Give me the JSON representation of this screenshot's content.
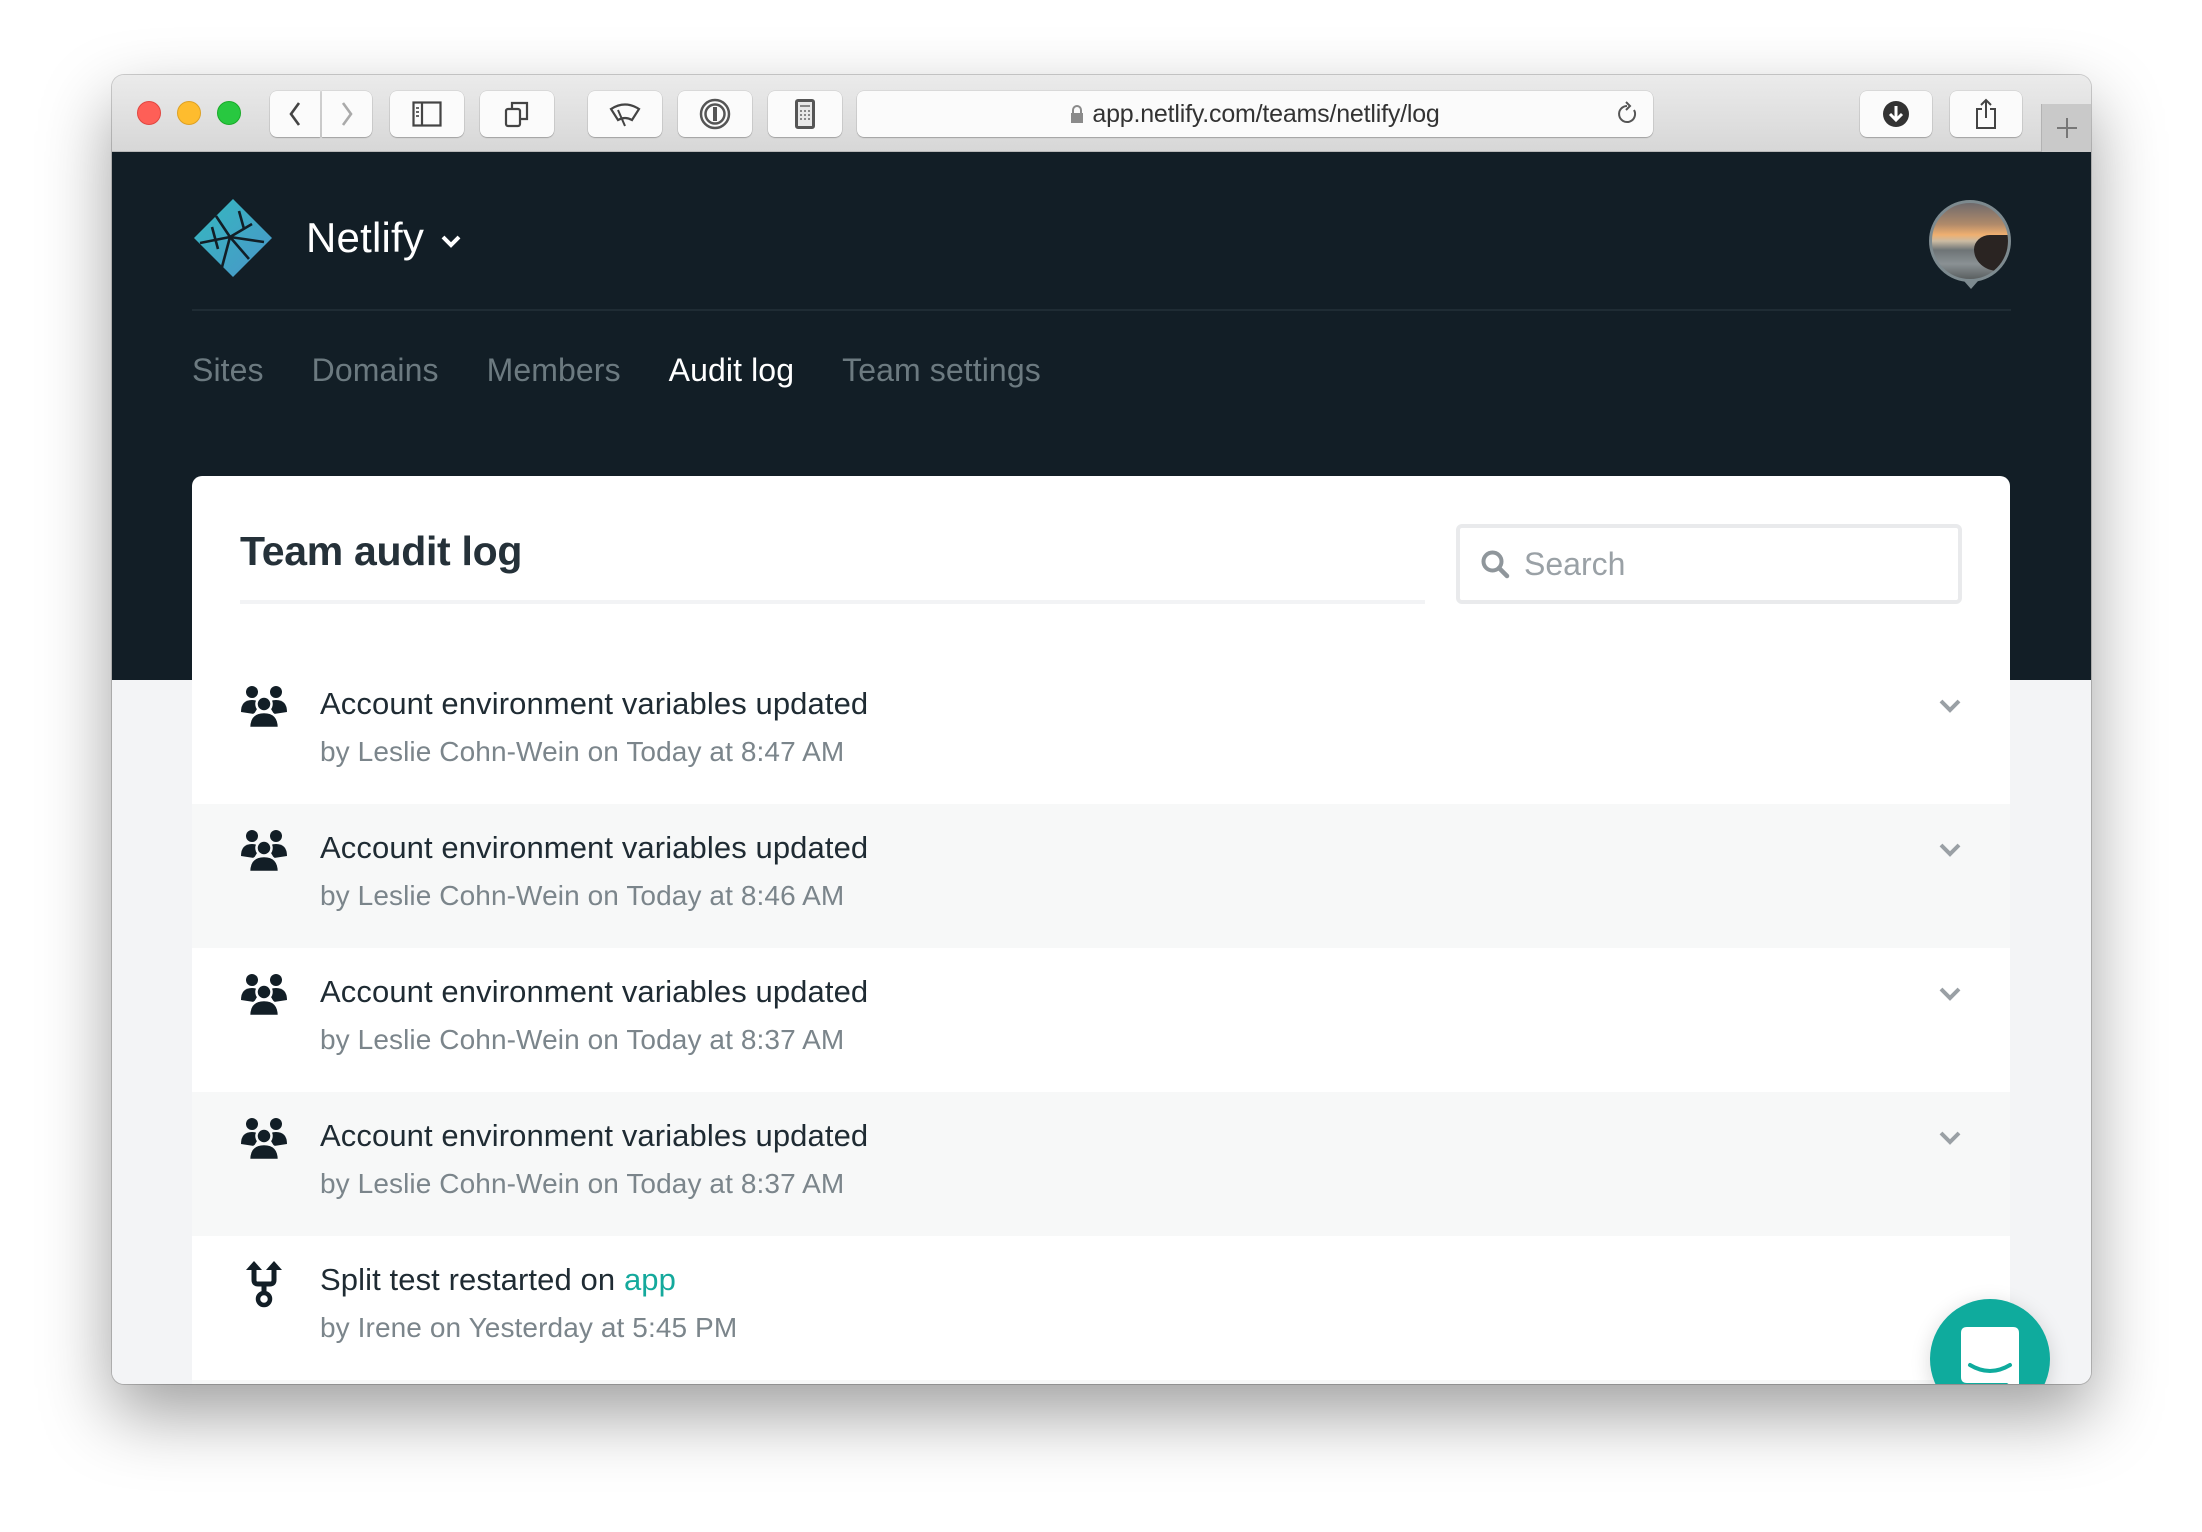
{
  "browser": {
    "url": "app.netlify.com/teams/netlify/log",
    "buttons": {
      "back": "back-icon",
      "forward": "forward-icon",
      "sidebar": "sidebar-icon",
      "tabs": "tab-overview-icon",
      "ext1": "wiper-icon",
      "ext2": "1password-icon",
      "ext3": "calculator-icon",
      "download": "download-icon",
      "share": "share-icon",
      "new_tab": "plus-icon"
    }
  },
  "header": {
    "brand": "Netlify",
    "nav": [
      {
        "label": "Sites",
        "active": false
      },
      {
        "label": "Domains",
        "active": false
      },
      {
        "label": "Members",
        "active": false
      },
      {
        "label": "Audit log",
        "active": true
      },
      {
        "label": "Team settings",
        "active": false
      }
    ]
  },
  "audit": {
    "title": "Team audit log",
    "search_placeholder": "Search",
    "search_value": "",
    "entries": [
      {
        "icon": "team-icon",
        "title": "Account environment variables updated",
        "link": "",
        "subtitle": "by Leslie Cohn-Wein on Today at 8:47 AM",
        "expandable": true
      },
      {
        "icon": "team-icon",
        "title": "Account environment variables updated",
        "link": "",
        "subtitle": "by Leslie Cohn-Wein on Today at 8:46 AM",
        "expandable": true
      },
      {
        "icon": "team-icon",
        "title": "Account environment variables updated",
        "link": "",
        "subtitle": "by Leslie Cohn-Wein on Today at 8:37 AM",
        "expandable": true
      },
      {
        "icon": "team-icon",
        "title": "Account environment variables updated",
        "link": "",
        "subtitle": "by Leslie Cohn-Wein on Today at 8:37 AM",
        "expandable": true
      },
      {
        "icon": "split-test-icon",
        "title": "Split test restarted on ",
        "link": "app",
        "subtitle": "by Irene on Yesterday at 5:45 PM",
        "expandable": false
      }
    ]
  },
  "colors": {
    "header_bg": "#121e26",
    "accent": "#14a99c",
    "chat_button": "#0fab9d",
    "nav_inactive": "#6c7a80"
  }
}
